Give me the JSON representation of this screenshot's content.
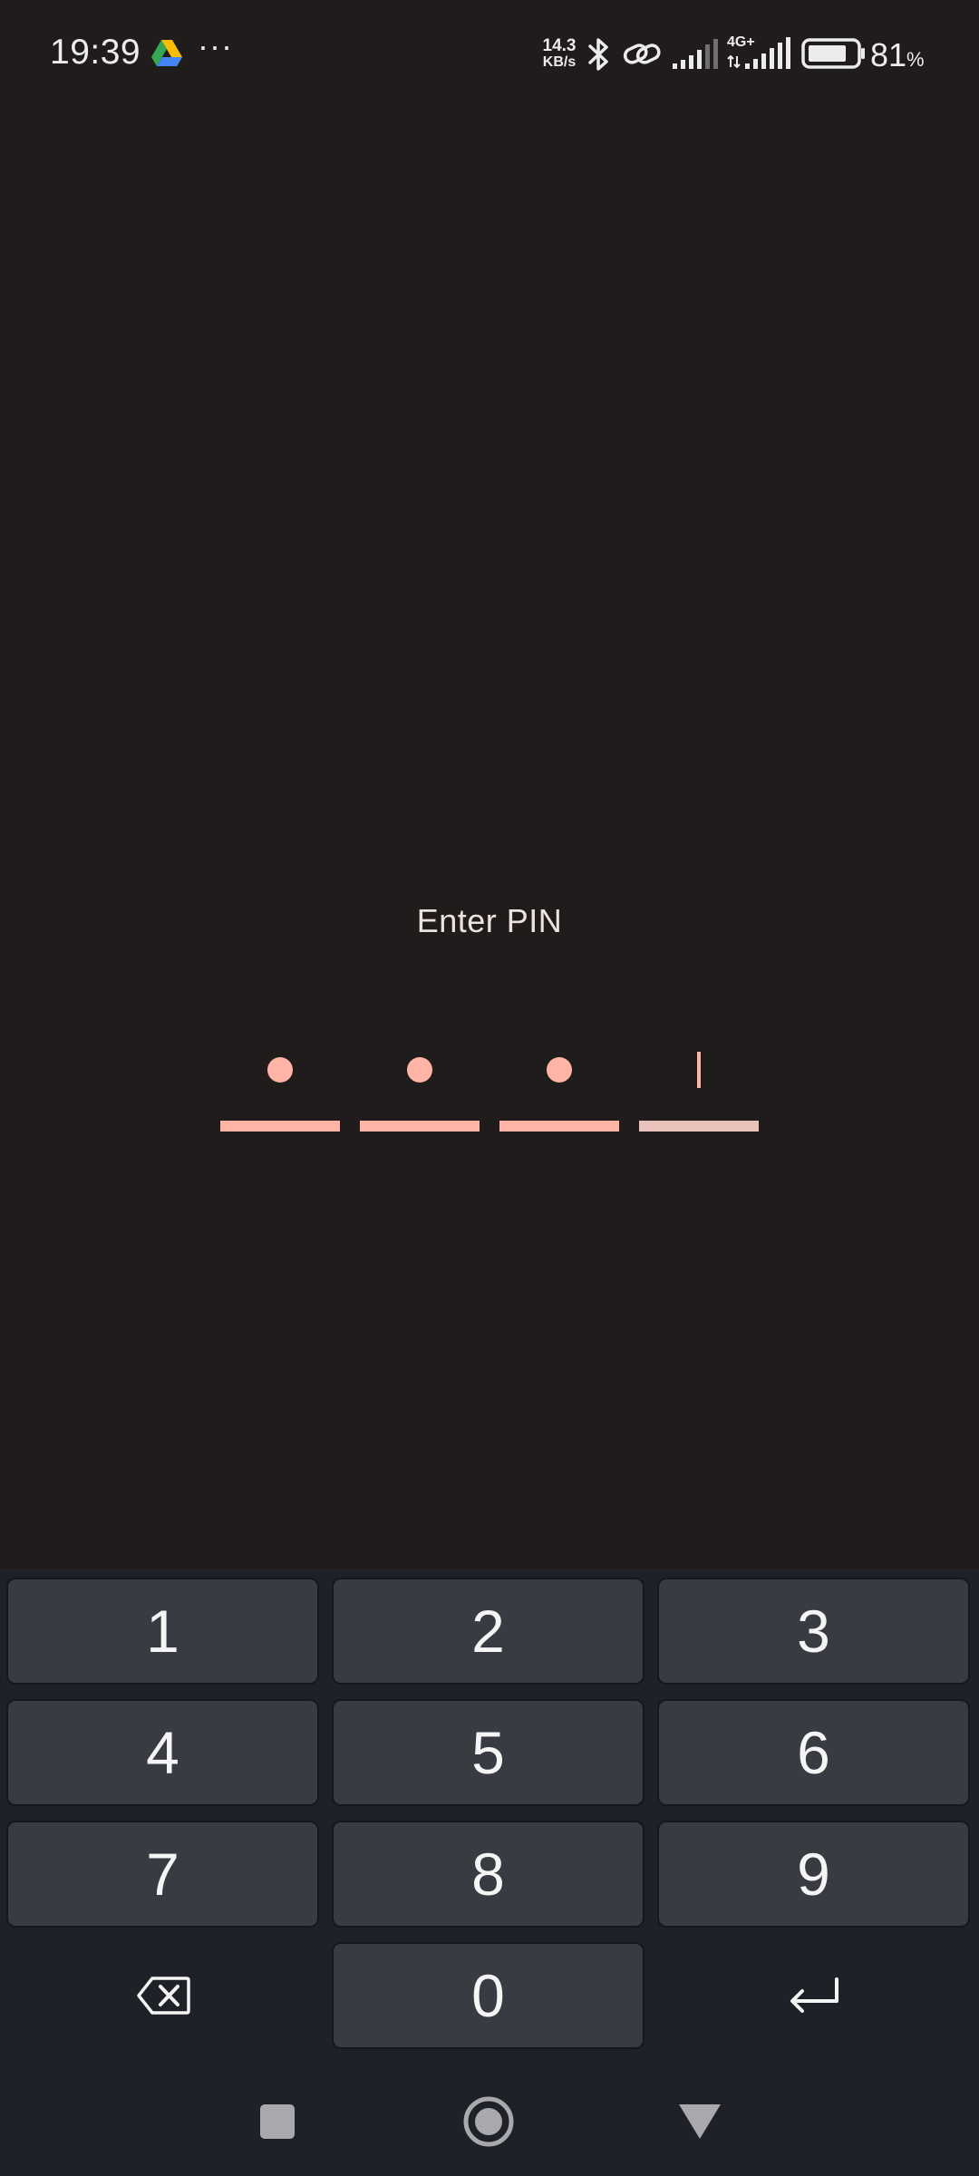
{
  "status_bar": {
    "time": "19:39",
    "more": "···",
    "net_speed_value": "14.3",
    "net_speed_unit": "KB/s",
    "network_type": "4G+",
    "battery_value": "81",
    "battery_unit": "%",
    "battery_level": 0.81,
    "icons": [
      "google-drive-icon",
      "bluetooth-icon",
      "link-icon",
      "signal-icon",
      "signal-4g-icon",
      "battery-icon"
    ]
  },
  "pin": {
    "title": "Enter PIN",
    "digits_entered": 3,
    "slots": 4
  },
  "keypad": {
    "keys": [
      "1",
      "2",
      "3",
      "4",
      "5",
      "6",
      "7",
      "8",
      "9",
      "0"
    ],
    "backspace_icon": "backspace-icon",
    "enter_icon": "enter-icon"
  },
  "navbar": {
    "icons": [
      "recents-square-icon",
      "home-circle-icon",
      "back-triangle-icon"
    ]
  },
  "colors": {
    "background": "#201c1b",
    "accent": "#ffb4a6",
    "key_bg": "#393b43",
    "keyboard_bg": "#1e2127"
  }
}
